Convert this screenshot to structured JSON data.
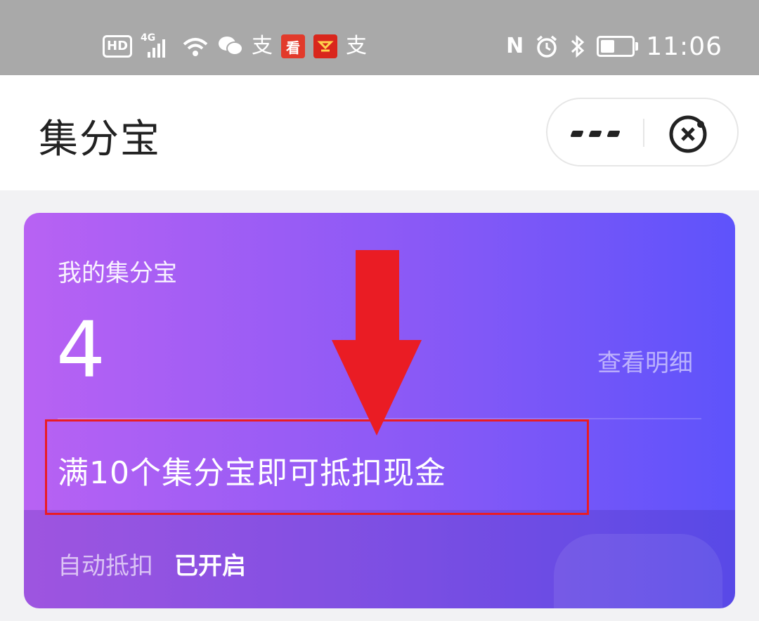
{
  "status_bar": {
    "left_icons": [
      "hd-icon",
      "4g-signal-icon",
      "wifi-icon",
      "wechat-icon",
      "alipay-icon",
      "kan-app-icon",
      "red-app-icon",
      "alipay-icon"
    ],
    "hd_label": "HD",
    "network_label": "4G",
    "kan_glyph": "看",
    "alipay_glyph": "支",
    "right_icons": [
      "nfc-icon",
      "alarm-icon",
      "bluetooth-icon",
      "battery-icon"
    ],
    "nfc_glyph": "N",
    "alarm_glyph": "⏰",
    "bluetooth_glyph": "ᛒ",
    "battery_level": 0.4,
    "time": "11:06"
  },
  "nav": {
    "title": "集分宝",
    "more_icon": "more-icon",
    "close_icon": "close-icon"
  },
  "card": {
    "label": "我的集分宝",
    "value": "4",
    "detail_link": "查看明细",
    "promo": "满10个集分宝即可抵扣现金",
    "auto_deduct_label": "自动抵扣",
    "auto_deduct_status": "已开启",
    "gradient_start": "#b862f3",
    "gradient_end": "#5e53fb"
  },
  "annotation": {
    "color": "#ea1c24"
  }
}
